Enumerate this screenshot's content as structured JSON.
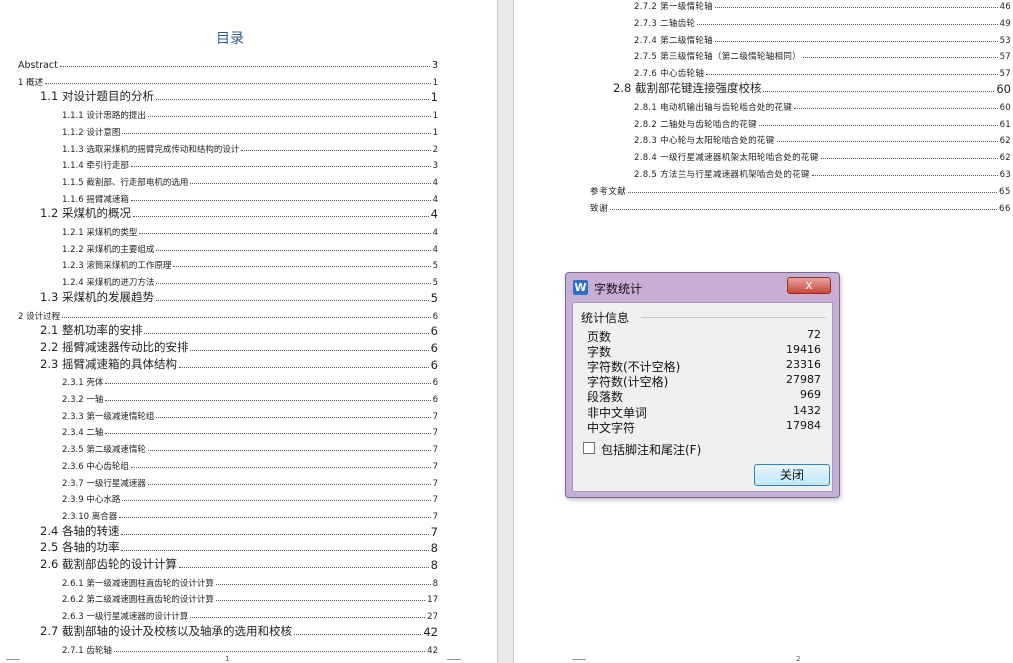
{
  "left_page": {
    "title": "目录",
    "page_number": "1",
    "rows": [
      {
        "t": "Abstract",
        "p": "3",
        "lv": "lv0"
      },
      {
        "t": "1 概述",
        "p": "1",
        "lv": "lv2"
      },
      {
        "t": "1.1 对设计题目的分析",
        "p": "1",
        "lv": "lv1"
      },
      {
        "t": "1.1.1 设计思路的提出",
        "p": "1",
        "lv": "lv2"
      },
      {
        "t": "1.1.2 设计意图",
        "p": "1",
        "lv": "lv2"
      },
      {
        "t": "1.1.3 选取采煤机的摇臂完成传动和结构的设计",
        "p": "2",
        "lv": "lv2"
      },
      {
        "t": "1.1.4 牵引行走部",
        "p": "3",
        "lv": "lv2"
      },
      {
        "t": "1.1.5 截割部、行走部电机的选用",
        "p": "4",
        "lv": "lv2"
      },
      {
        "t": "1.1.6 摇臂减速箱",
        "p": "4",
        "lv": "lv2"
      },
      {
        "t": "1.2 采煤机的概况",
        "p": "4",
        "lv": "lv1"
      },
      {
        "t": "1.2.1 采煤机的类型",
        "p": "4",
        "lv": "lv2"
      },
      {
        "t": "1.2.2 采煤机的主要组成",
        "p": "4",
        "lv": "lv2"
      },
      {
        "t": "1.2.3 滚筒采煤机的工作原理",
        "p": "5",
        "lv": "lv2"
      },
      {
        "t": "1.2.4 采煤机的进刀方法",
        "p": "5",
        "lv": "lv2"
      },
      {
        "t": "1.3 采煤机的发展趋势",
        "p": "5",
        "lv": "lv1"
      },
      {
        "t": "2 设计过程",
        "p": "6",
        "lv": "lv2"
      },
      {
        "t": "2.1 整机功率的安排",
        "p": "6",
        "lv": "lv1"
      },
      {
        "t": "2.2 摇臂减速器传动比的安排",
        "p": "6",
        "lv": "lv1"
      },
      {
        "t": "2.3 摇臂减速箱的具体结构",
        "p": "6",
        "lv": "lv1"
      },
      {
        "t": "2.3.1 壳体",
        "p": "6",
        "lv": "lv2"
      },
      {
        "t": "2.3.2 一轴",
        "p": "6",
        "lv": "lv2"
      },
      {
        "t": "2.3.3 第一级减速惰轮组",
        "p": "7",
        "lv": "lv2"
      },
      {
        "t": "2.3.4 二轴",
        "p": "7",
        "lv": "lv2"
      },
      {
        "t": "2.3.5 第二级减速惰轮",
        "p": "7",
        "lv": "lv2"
      },
      {
        "t": "2.3.6 中心齿轮组",
        "p": "7",
        "lv": "lv2"
      },
      {
        "t": "2.3.7 一级行星减速器",
        "p": "7",
        "lv": "lv2"
      },
      {
        "t": "2.3.9 中心水路",
        "p": "7",
        "lv": "lv2"
      },
      {
        "t": "2.3.10 离合器",
        "p": "7",
        "lv": "lv2"
      },
      {
        "t": "2.4 各轴的转速",
        "p": "7",
        "lv": "lv1"
      },
      {
        "t": "2.5 各轴的功率",
        "p": "8",
        "lv": "lv1"
      },
      {
        "t": "2.6 截割部齿轮的设计计算",
        "p": "8",
        "lv": "lv1"
      },
      {
        "t": "2.6.1 第一级减速圆柱直齿轮的设计计算",
        "p": "8",
        "lv": "lv2"
      },
      {
        "t": "2.6.2 第二级减速圆柱直齿轮的设计计算",
        "p": "17",
        "lv": "lv2"
      },
      {
        "t": "2.6.3 一级行星减速器的设计计算",
        "p": "27",
        "lv": "lv2"
      },
      {
        "t": "2.7 截割部轴的设计及校核以及轴承的选用和校核",
        "p": "42",
        "lv": "lv1"
      },
      {
        "t": "2.7.1 齿轮轴",
        "p": "42",
        "lv": "lv2"
      }
    ]
  },
  "right_page": {
    "page_number": "2",
    "rows": [
      {
        "t": "2.7.2 第一级惰轮轴",
        "p": "46",
        "lv": "lv2r"
      },
      {
        "t": "2.7.3 二轴齿轮",
        "p": "49",
        "lv": "lv2r"
      },
      {
        "t": "2.7.4 第二级惰轮轴",
        "p": "53",
        "lv": "lv2r"
      },
      {
        "t": "2.7.5 第三级惰轮轴（第二级惰轮轴相同）",
        "p": "57",
        "lv": "lv2r"
      },
      {
        "t": "2.7.6 中心齿轮轴",
        "p": "57",
        "lv": "lv2r"
      },
      {
        "t": "2.8 截割部花键连接强度校核",
        "p": "60",
        "lv": "lv1"
      },
      {
        "t": "2.8.1 电动机输出轴与齿轮啮合处的花键",
        "p": "60",
        "lv": "lv2r"
      },
      {
        "t": "2.8.2 二轴处与齿轮啮合的花键",
        "p": "61",
        "lv": "lv2r"
      },
      {
        "t": "2.8.3 中心轮与太阳轮啮合处的花键",
        "p": "62",
        "lv": "lv2r"
      },
      {
        "t": "2.8.4 一级行星减速器机架太阳轮啮合处的花键",
        "p": "62",
        "lv": "lv2r"
      },
      {
        "t": "2.8.5 方法兰与行星减速器机架啮合处的花键",
        "p": "63",
        "lv": "lv2r"
      },
      {
        "t": "参考文献",
        "p": "65",
        "lv": "lvR"
      },
      {
        "t": "致谢",
        "p": "66",
        "lv": "lvR"
      }
    ]
  },
  "dialog": {
    "app_icon": "W",
    "title": "字数统计",
    "close_x": "x",
    "group_label": "统计信息",
    "stats": [
      {
        "k": "页数",
        "v": "72"
      },
      {
        "k": "字数",
        "v": "19416"
      },
      {
        "k": "字符数(不计空格)",
        "v": "23316"
      },
      {
        "k": "字符数(计空格)",
        "v": "27987"
      },
      {
        "k": "段落数",
        "v": "969"
      },
      {
        "k": "非中文单词",
        "v": "1432"
      },
      {
        "k": "中文字符",
        "v": "17984"
      }
    ],
    "checkbox_label": "包括脚注和尾注(F)",
    "checkbox_checked": false,
    "close_button": "关闭"
  }
}
